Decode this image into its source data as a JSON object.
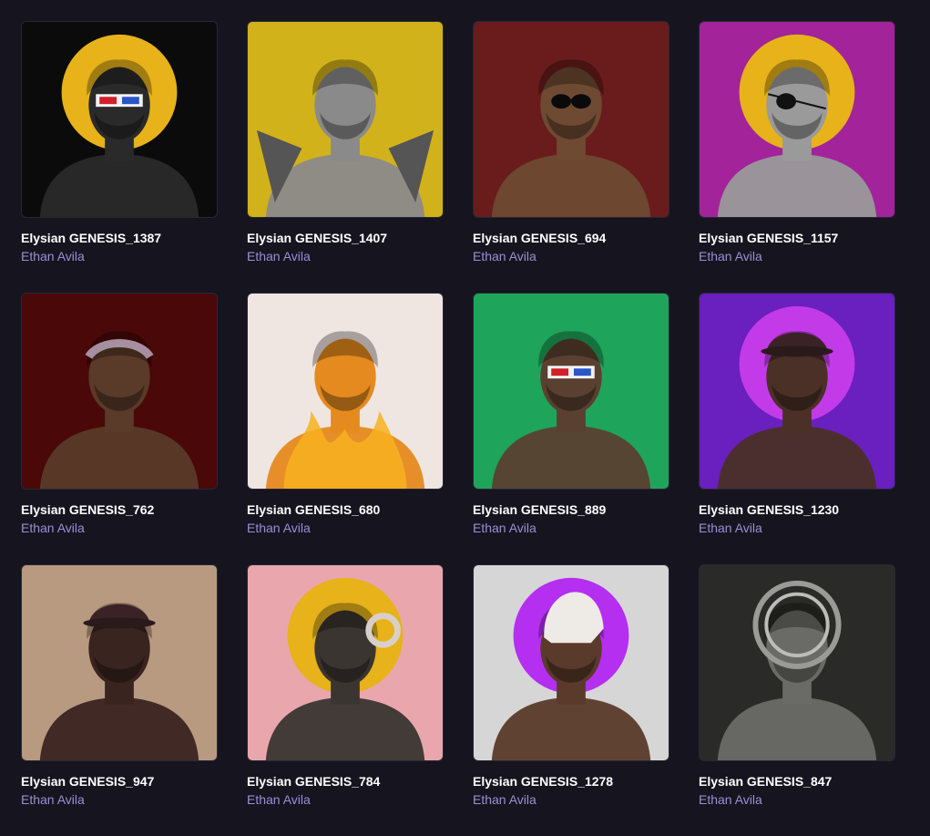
{
  "gallery": {
    "items": [
      {
        "title": "Elysian GENESIS_1387",
        "artist": "Ethan Avila",
        "background": "#0b0b0b",
        "halo": "#e7b21a",
        "bust": "#2a2a2a",
        "accessory": "3d-glasses-icon"
      },
      {
        "title": "Elysian GENESIS_1407",
        "artist": "Ethan Avila",
        "background": "#d2b21a",
        "halo": "",
        "bust": "#8a8a8a",
        "accessory": "wings-icon"
      },
      {
        "title": "Elysian GENESIS_694",
        "artist": "Ethan Avila",
        "background": "#6a1c1c",
        "halo": "",
        "bust": "#6e4a32",
        "accessory": "sunglasses-icon"
      },
      {
        "title": "Elysian GENESIS_1157",
        "artist": "Ethan Avila",
        "background": "#a3239a",
        "halo": "#e7b21a",
        "bust": "#9a9a9a",
        "accessory": "eyepatch-icon"
      },
      {
        "title": "Elysian GENESIS_762",
        "artist": "Ethan Avila",
        "background": "#4a0808",
        "halo": "",
        "bust": "#5a3a28",
        "accessory": "laurel-icon"
      },
      {
        "title": "Elysian GENESIS_680",
        "artist": "Ethan Avila",
        "background": "#efe6e2",
        "halo": "",
        "bust": "#e58a1e",
        "accessory": "flame-icon"
      },
      {
        "title": "Elysian GENESIS_889",
        "artist": "Ethan Avila",
        "background": "#1fa45b",
        "halo": "",
        "bust": "#5a4030",
        "accessory": "3d-glasses-icon"
      },
      {
        "title": "Elysian GENESIS_1230",
        "artist": "Ethan Avila",
        "background": "#6a1fbf",
        "halo": "#c33be8",
        "bust": "#4a3026",
        "accessory": "helmet-icon"
      },
      {
        "title": "Elysian GENESIS_947",
        "artist": "Ethan Avila",
        "background": "#b89a80",
        "halo": "",
        "bust": "#3a2420",
        "accessory": "winged-helmet-icon"
      },
      {
        "title": "Elysian GENESIS_784",
        "artist": "Ethan Avila",
        "background": "#e9a6ad",
        "halo": "#e7b21a",
        "bust": "#3a3530",
        "accessory": "ram-horn-icon"
      },
      {
        "title": "Elysian GENESIS_1278",
        "artist": "Ethan Avila",
        "background": "#d6d6d6",
        "halo": "#b52ff0",
        "bust": "#5a3a2a",
        "accessory": "corinthian-helmet-icon"
      },
      {
        "title": "Elysian GENESIS_847",
        "artist": "Ethan Avila",
        "background": "#2a2a28",
        "halo": "",
        "bust": "#6a6a66",
        "accessory": "medusa-icon"
      }
    ]
  }
}
